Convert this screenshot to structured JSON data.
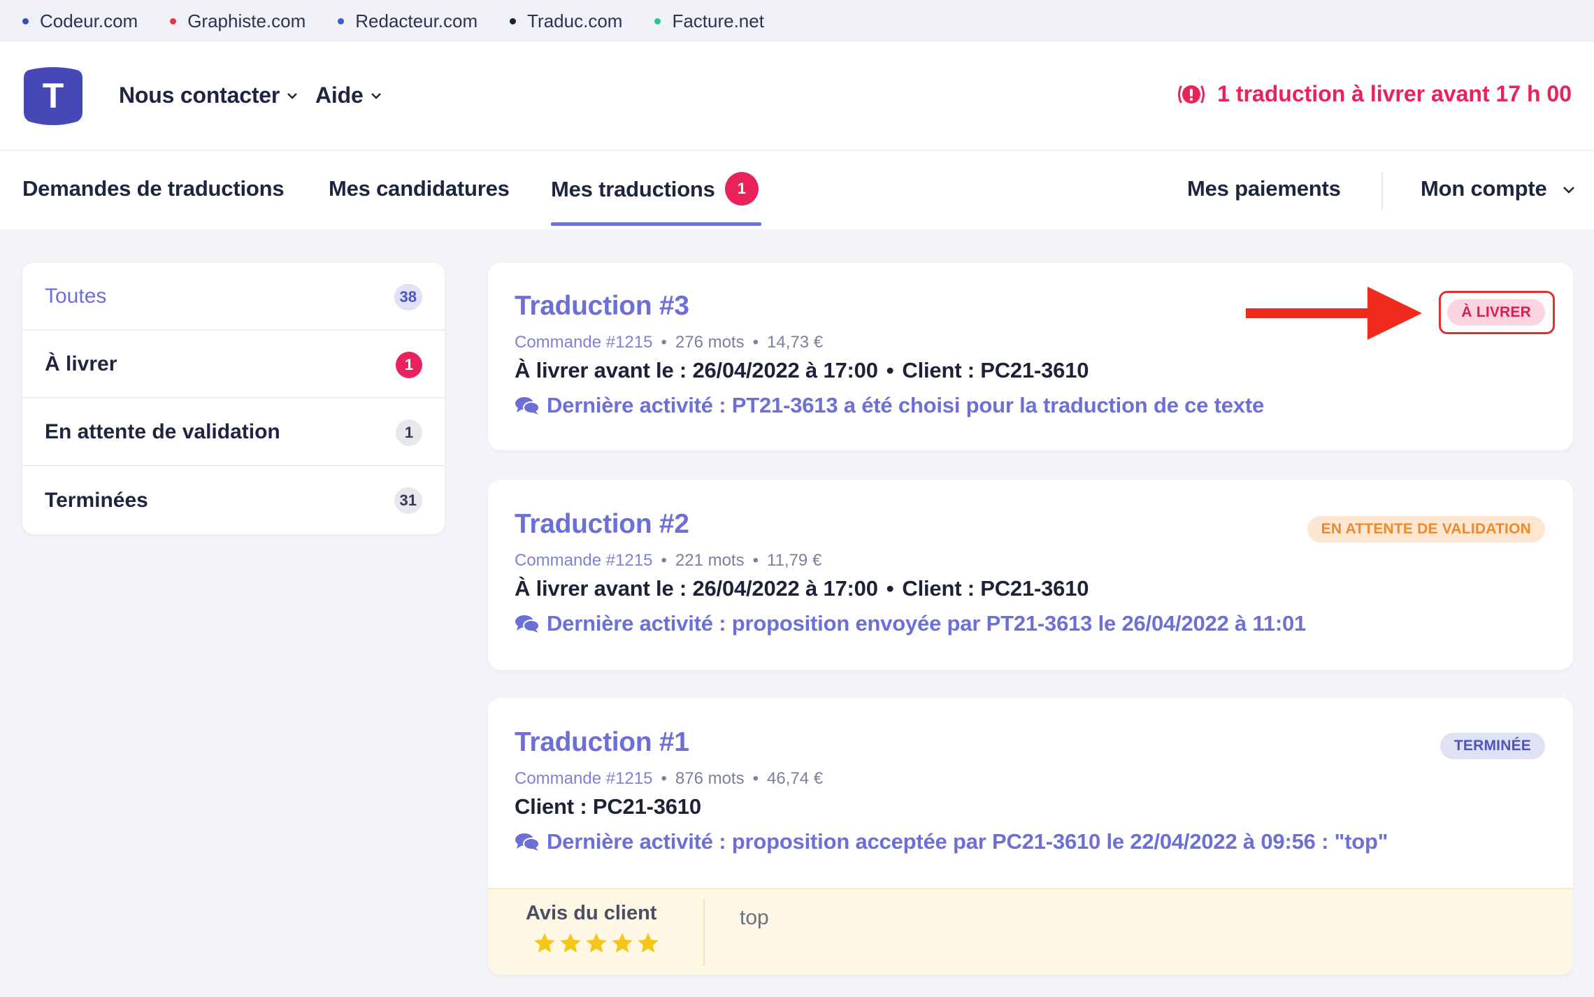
{
  "network": [
    {
      "label": "Codeur.com",
      "color": "#3a4fb3"
    },
    {
      "label": "Graphiste.com",
      "color": "#e8334a"
    },
    {
      "label": "Redacteur.com",
      "color": "#3a5fc8"
    },
    {
      "label": "Traduc.com",
      "color": "#1c2237"
    },
    {
      "label": "Facture.net",
      "color": "#2bc48a"
    }
  ],
  "header": {
    "logo_letter": "T",
    "contact_label": "Nous contacter",
    "help_label": "Aide",
    "alert_text": "1 traduction à livrer avant 17 h 00"
  },
  "tabs": {
    "requests": "Demandes de traductions",
    "applications": "Mes candidatures",
    "translations": "Mes traductions",
    "translations_badge": "1",
    "payments": "Mes paiements",
    "account": "Mon compte"
  },
  "filters": [
    {
      "label": "Toutes",
      "count": "38"
    },
    {
      "label": "À livrer",
      "count": "1"
    },
    {
      "label": "En attente de validation",
      "count": "1"
    },
    {
      "label": "Terminées",
      "count": "31"
    }
  ],
  "cards": [
    {
      "title": "Traduction #3",
      "order": "Commande #1215",
      "words": "276 mots",
      "price": "14,73 €",
      "deadline": "À livrer avant le : 26/04/2022 à 17:00",
      "client": "Client : PC21-3610",
      "activity": "Dernière activité : PT21-3613 a été choisi pour la traduction de ce texte",
      "status": "À LIVRER"
    },
    {
      "title": "Traduction #2",
      "order": "Commande #1215",
      "words": "221 mots",
      "price": "11,79 €",
      "deadline": "À livrer avant le : 26/04/2022 à 17:00",
      "client": "Client : PC21-3610",
      "activity": "Dernière activité : proposition envoyée par PT21-3613 le 26/04/2022 à 11:01",
      "status": "EN ATTENTE DE VALIDATION"
    },
    {
      "title": "Traduction #1",
      "order": "Commande #1215",
      "words": "876 mots",
      "price": "46,74 €",
      "client": "Client : PC21-3610",
      "activity": "Dernière activité : proposition acceptée par PC21-3610 le 22/04/2022 à 09:56 : \"top\"",
      "status": "TERMINÉE",
      "review_label": "Avis du client",
      "review_rating": 5,
      "review_text": "top"
    }
  ],
  "colors": {
    "accent": "#6b6fd6",
    "alert": "#e8225a",
    "arrow": "#ef2b1d"
  }
}
